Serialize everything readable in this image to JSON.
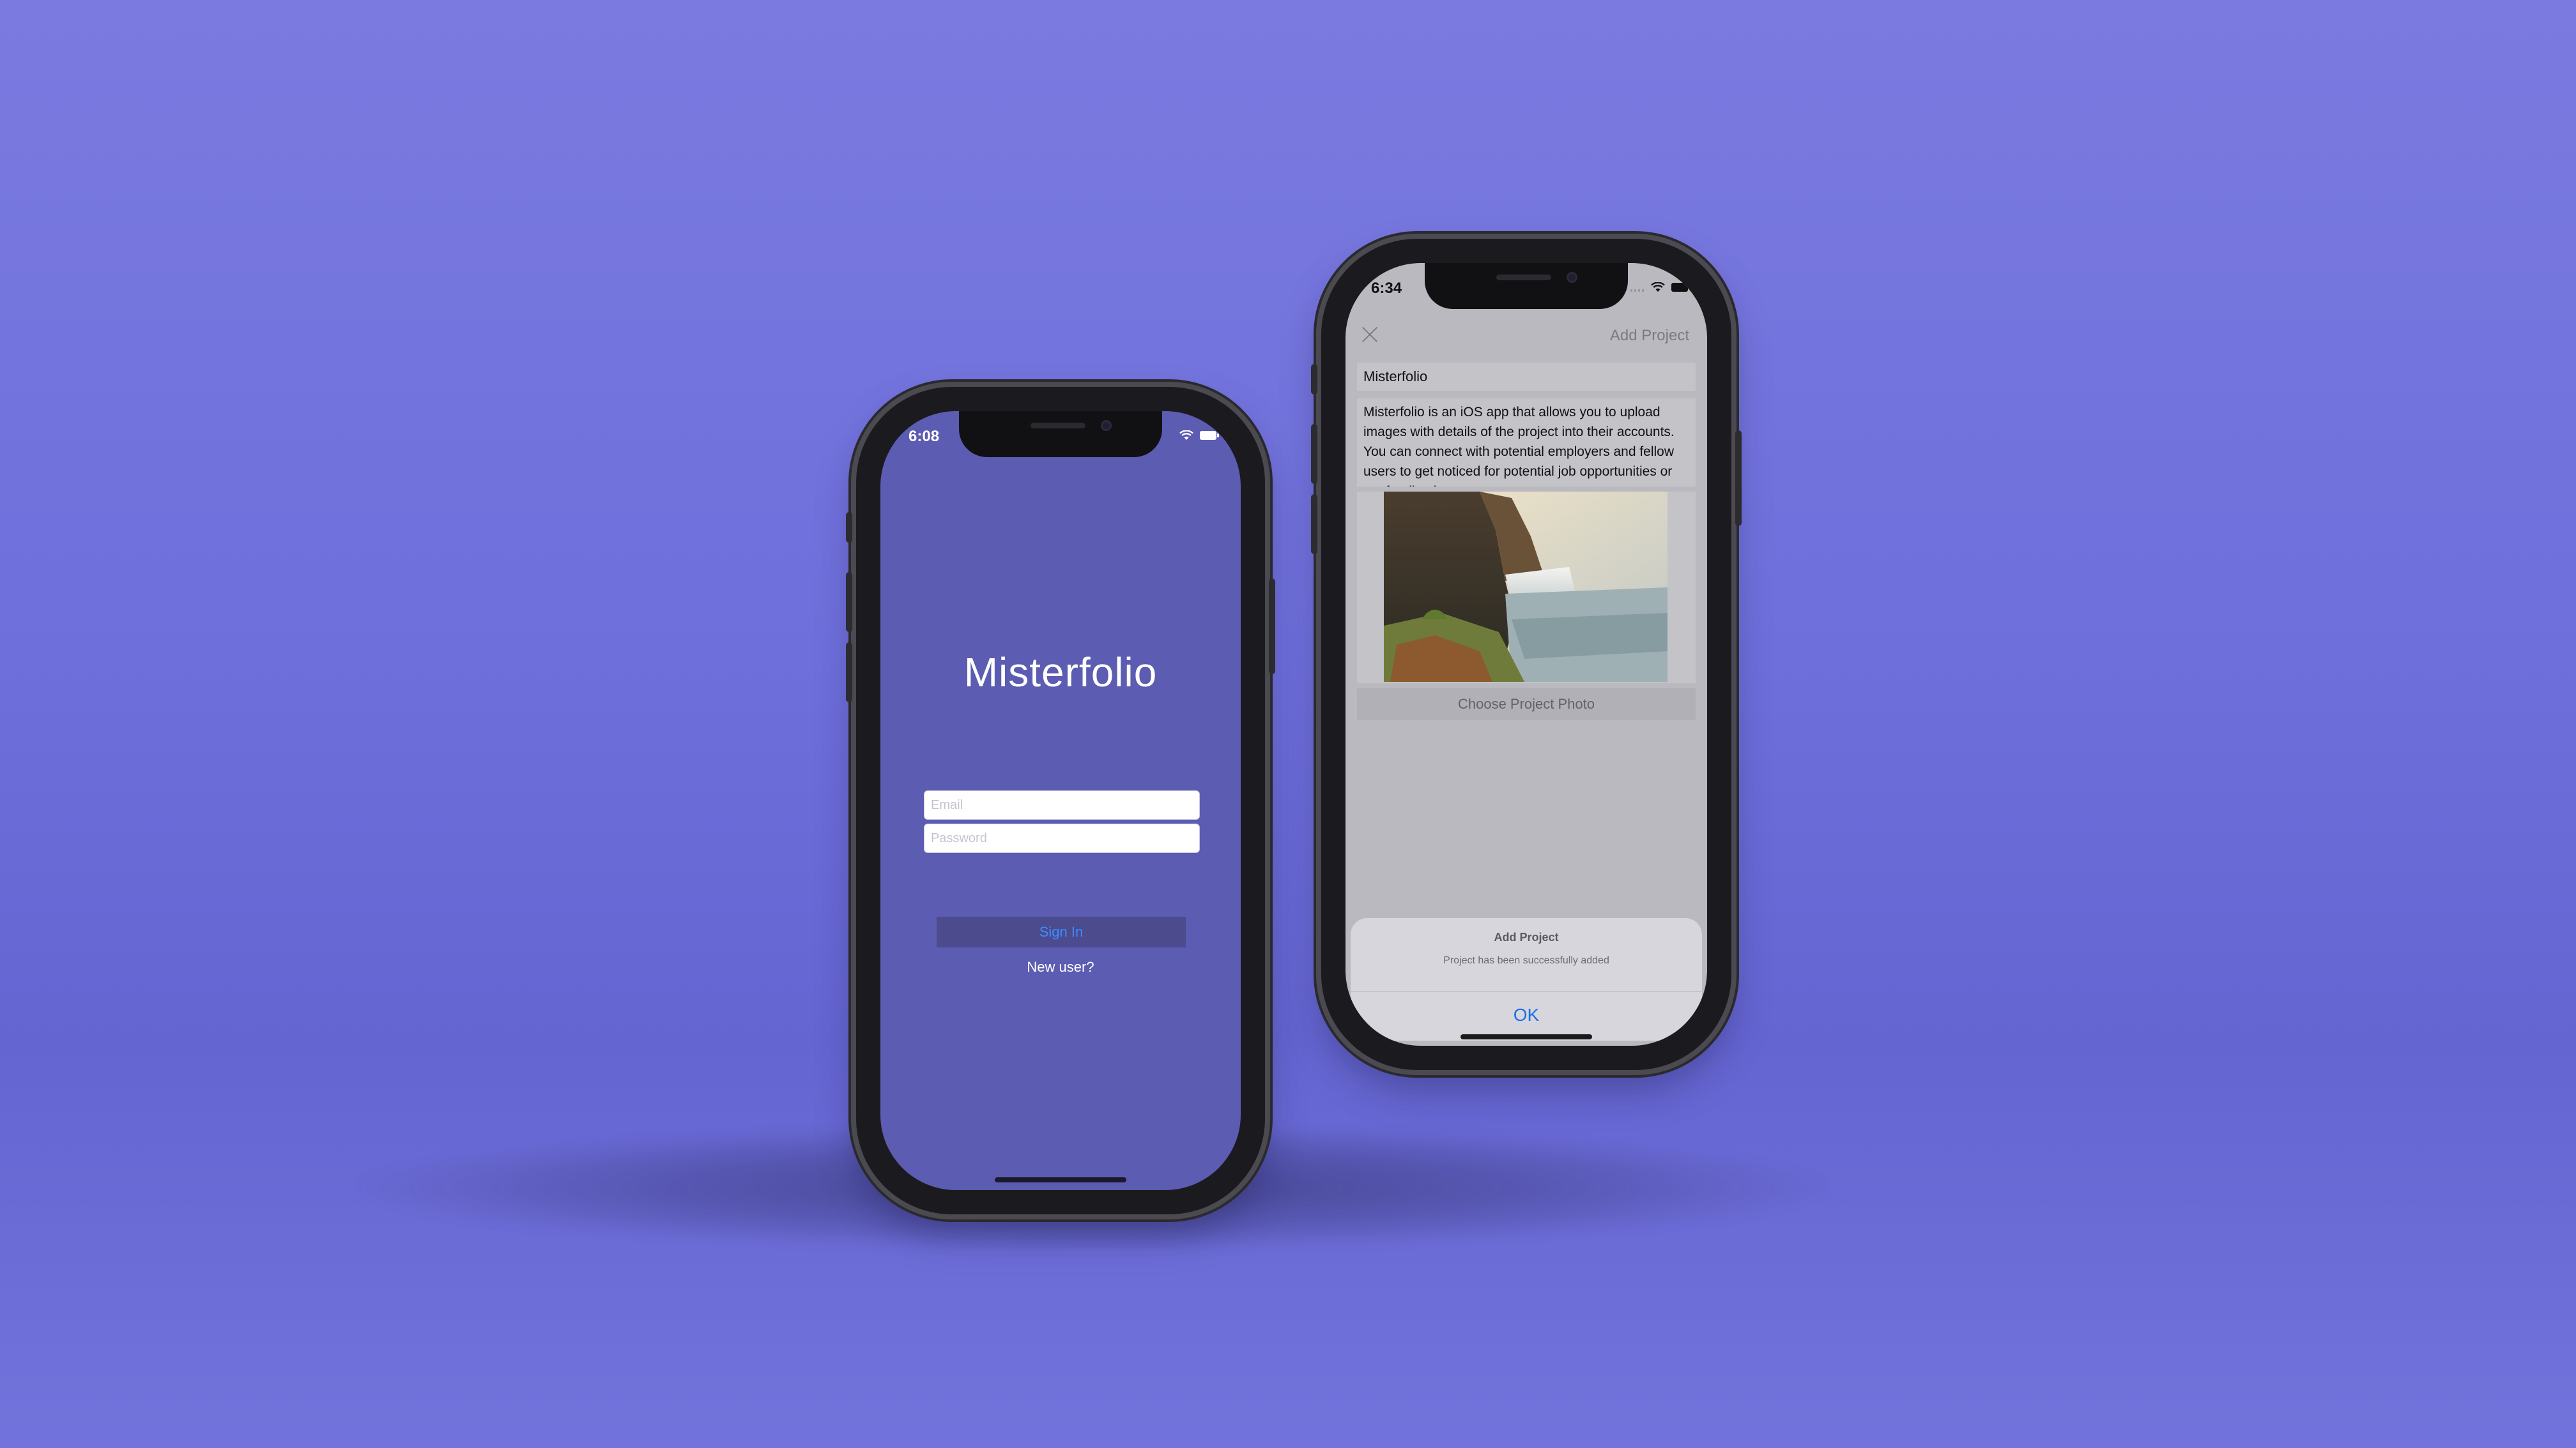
{
  "colors": {
    "accent_blue": "#3d8bff",
    "login_bg": "#5c5cb2",
    "page_bg": "#7373dc"
  },
  "login_screen": {
    "status_time": "6:08",
    "app_title": "Misterfolio",
    "email_placeholder": "Email",
    "password_placeholder": "Password",
    "sign_in_label": "Sign In",
    "new_user_label": "New user?"
  },
  "add_project_screen": {
    "status_time": "6:34",
    "nav_title": "Add Project",
    "close_icon": "close-icon",
    "project_name": "Misterfolio",
    "project_description": "Misterfolio is an iOS app that allows you to upload images with details of the project into their accounts. You can connect with potential employers and fellow users to get noticed for potential job opportunities or get feedbacks on",
    "photo_icon": "waterfall-landscape-image",
    "choose_photo_label": "Choose Project Photo",
    "alert": {
      "title": "Add Project",
      "message": "Project has been successfully added",
      "ok_label": "OK"
    }
  }
}
